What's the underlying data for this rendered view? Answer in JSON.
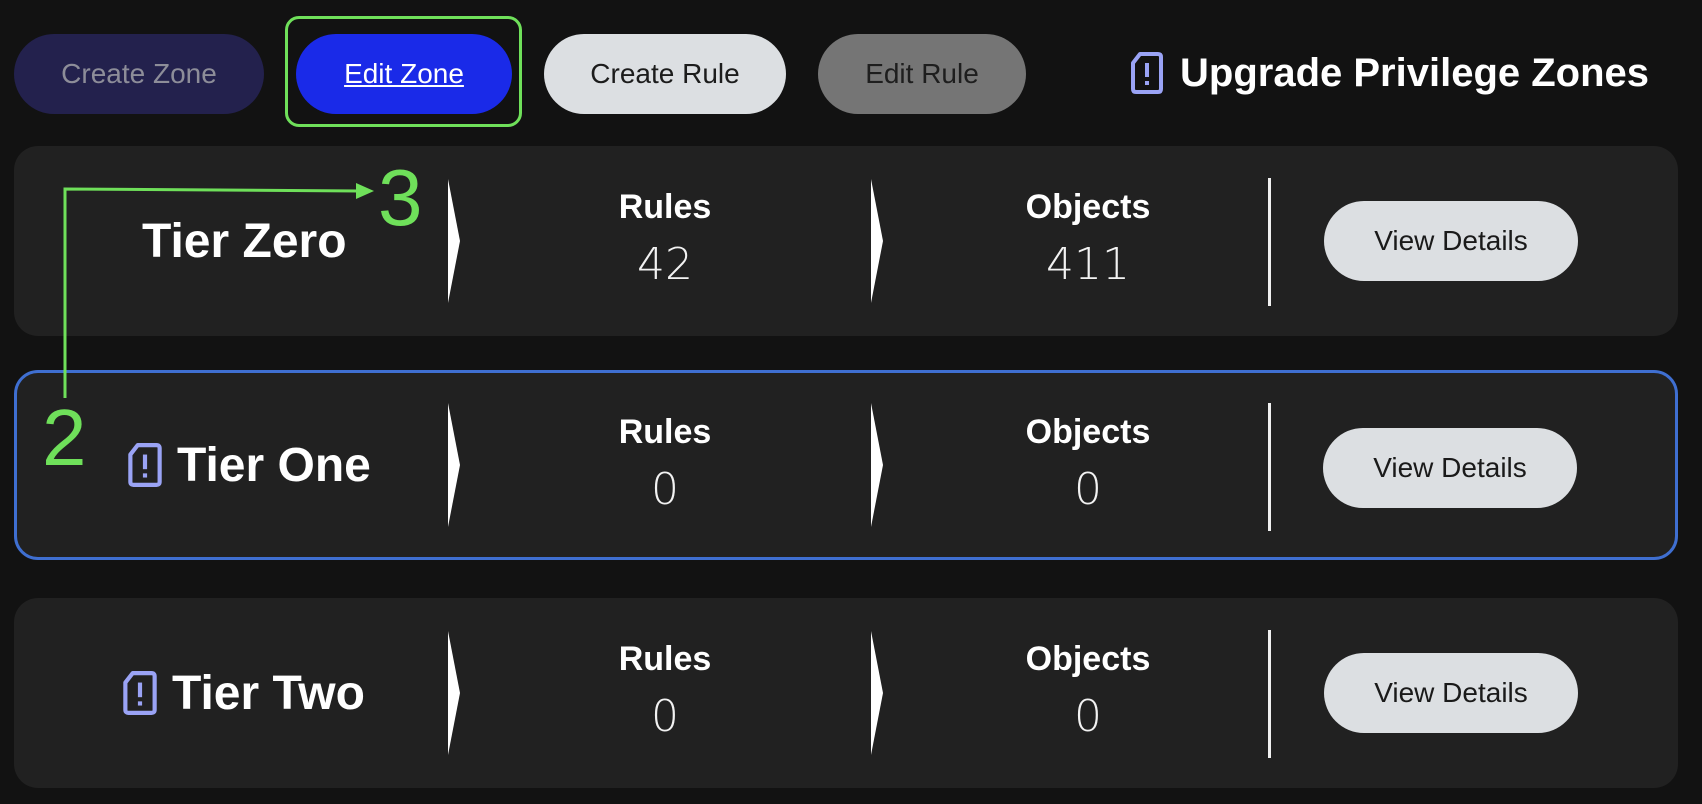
{
  "toolbar": {
    "create_zone": "Create Zone",
    "edit_zone": "Edit Zone",
    "create_rule": "Create Rule",
    "edit_rule": "Edit Rule",
    "upgrade_label": "Upgrade Privilege Zones"
  },
  "zones": [
    {
      "name": "Tier Zero",
      "rules_label": "Rules",
      "rules": "42",
      "objects_label": "Objects",
      "objects": "411",
      "action": "View Details",
      "icon": "none",
      "selected": false
    },
    {
      "name": "Tier One",
      "rules_label": "Rules",
      "rules": "0",
      "objects_label": "Objects",
      "objects": "0",
      "action": "View Details",
      "icon": "alert-tag-icon",
      "selected": true
    },
    {
      "name": "Tier Two",
      "rules_label": "Rules",
      "rules": "0",
      "objects_label": "Objects",
      "objects": "0",
      "action": "View Details",
      "icon": "alert-tag-icon",
      "selected": false
    }
  ],
  "annotations": {
    "step_2": "2",
    "step_3": "3",
    "color": "#6fe05a"
  },
  "colors": {
    "background": "#121212",
    "card": "#212121",
    "accent_blue": "#1a2ae8",
    "icon_purple": "#9aa3f5",
    "selected_border": "#3f6fd1"
  }
}
